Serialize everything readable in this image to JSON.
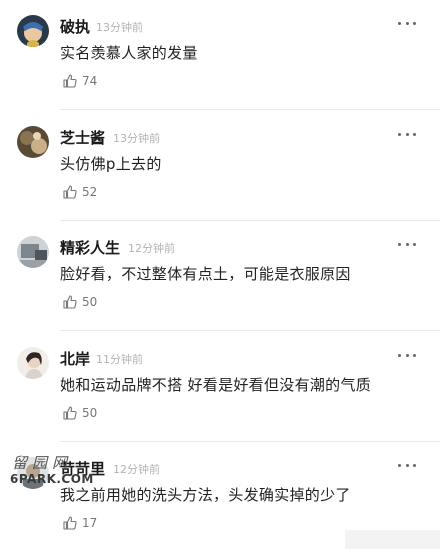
{
  "comments": [
    {
      "author": "破执",
      "time": "13分钟前",
      "text": "实名羡慕人家的发量",
      "likes": "74"
    },
    {
      "author": "芝士酱",
      "time": "13分钟前",
      "text": "头仿佛p上去的",
      "likes": "52"
    },
    {
      "author": "精彩人生",
      "time": "12分钟前",
      "text": "脸好看，不过整体有点土，可能是衣服原因",
      "likes": "50"
    },
    {
      "author": "北岸",
      "time": "11分钟前",
      "text": "她和运动品牌不搭 好看是好看但没有潮的气质",
      "likes": "50"
    },
    {
      "author": "苛苛里",
      "time": "12分钟前",
      "text": "我之前用她的洗头方法，头发确实掉的少了",
      "likes": "17"
    }
  ],
  "watermark": {
    "top": "留园网",
    "bottom": "6PARK.COM"
  },
  "icons": {
    "more": "more-dots-icon",
    "like": "thumbs-up-icon"
  }
}
